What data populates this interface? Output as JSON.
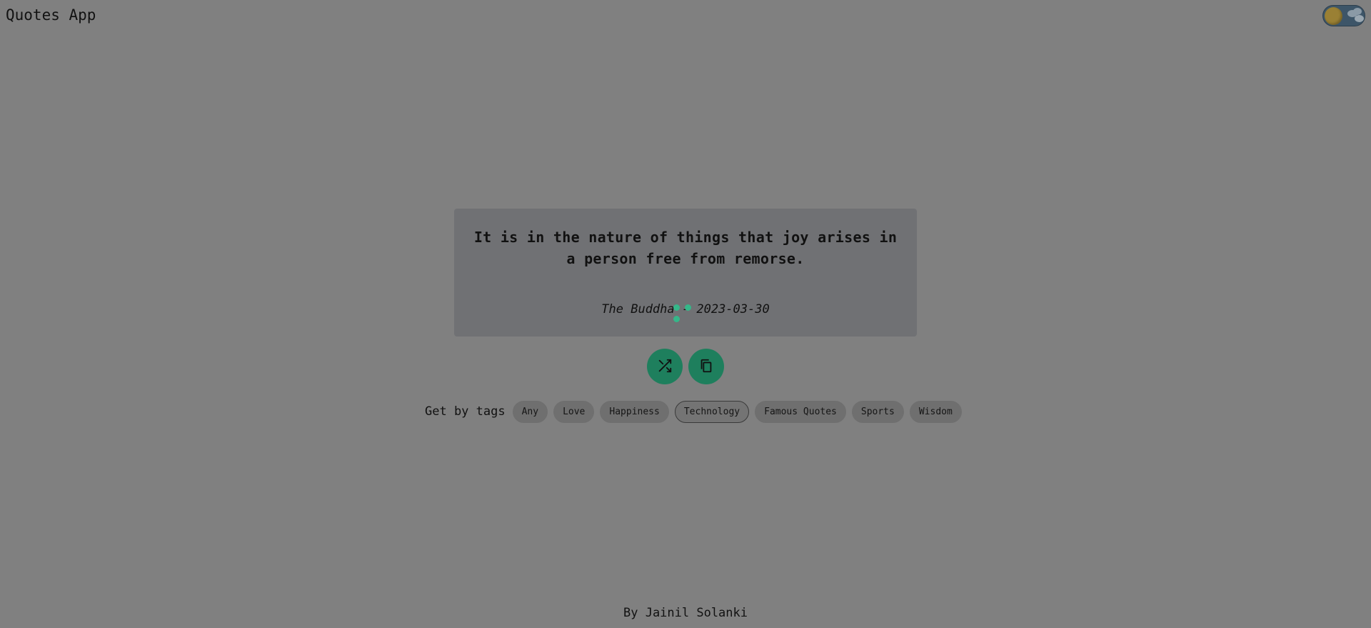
{
  "header": {
    "title": "Quotes App"
  },
  "theme_toggle": {
    "state": "dark"
  },
  "quote": {
    "text": "It is in the nature of things that joy arises in a person free from remorse.",
    "author": "The Buddha",
    "separator": " - ",
    "date": "2023-03-30"
  },
  "actions": {
    "random_icon": "shuffle-icon",
    "copy_icon": "copy-icon"
  },
  "tags": {
    "label": "Get by tags",
    "items": [
      {
        "label": "Any",
        "active": false
      },
      {
        "label": "Love",
        "active": false
      },
      {
        "label": "Happiness",
        "active": false
      },
      {
        "label": "Technology",
        "active": true
      },
      {
        "label": "Famous Quotes",
        "active": false
      },
      {
        "label": "Sports",
        "active": false
      },
      {
        "label": "Wisdom",
        "active": false
      }
    ]
  },
  "footer": {
    "credit": "By Jainil Solanki"
  },
  "colors": {
    "background": "#808080",
    "card": "#707174",
    "accent": "#1e7f5d",
    "loader": "#35b789"
  }
}
